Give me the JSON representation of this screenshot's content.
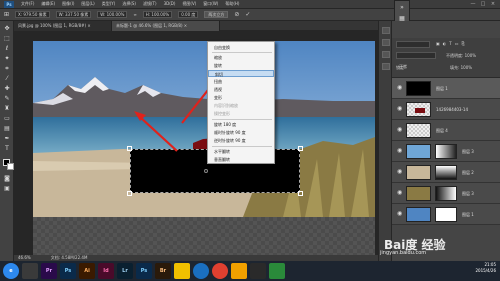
{
  "menubar": {
    "logo": "Ps",
    "items": [
      "文件(F)",
      "编辑(E)",
      "图像(I)",
      "图层(L)",
      "类型(Y)",
      "选择(S)",
      "滤镜(T)",
      "3D(D)",
      "视图(V)",
      "窗口(W)",
      "帮助(H)"
    ],
    "window_controls": [
      "—",
      "□",
      "×"
    ]
  },
  "options_bar": {
    "x": "X: 979.50 像素",
    "w": "W: 337.50 像素",
    "w_pct": "W: 100.00%",
    "h_pct": "H: 100.00%",
    "angle": "0.00 度",
    "interp": "两次立方",
    "commit_icon": "check-icon",
    "cancel_icon": "cancel-icon"
  },
  "doc_tabs": [
    {
      "label": "风景.jpg @ 100% (图层 1, RGB/8#) ×",
      "active": false
    },
    {
      "label": "未标题-1 @ 46.6% (图层 1, RGB/8) × ",
      "active": true
    }
  ],
  "status": {
    "zoom": "46.6%",
    "doc": "文档: 4.58M/22.4M"
  },
  "context_menu": {
    "items": [
      {
        "label": "自由变换",
        "disabled": false
      },
      {
        "label": "缩放",
        "disabled": false
      },
      {
        "label": "旋转",
        "disabled": false
      },
      {
        "label": "斜切",
        "disabled": false,
        "highlighted": true
      },
      {
        "label": "扭曲",
        "disabled": false
      },
      {
        "label": "透视",
        "disabled": false
      },
      {
        "label": "变形",
        "disabled": false
      },
      {
        "label": "内容识别缩放",
        "disabled": true
      },
      {
        "label": "操控变形",
        "disabled": true
      },
      {
        "label": "旋转 180 度",
        "disabled": false
      },
      {
        "label": "顺时针旋转 90 度",
        "disabled": false
      },
      {
        "label": "逆时针旋转 90 度",
        "disabled": false
      },
      {
        "label": "水平翻转",
        "disabled": false
      },
      {
        "label": "垂直翻转",
        "disabled": false
      }
    ]
  },
  "layers_panel": {
    "filter_label": "类型",
    "blend_mode": "正常",
    "opacity_label": "不透明度: 100%",
    "lock_label": "锁定:",
    "fill_label": "填充: 100%",
    "layers": [
      {
        "name": "图层 1",
        "selected": true
      },
      {
        "name": "1426984403-14",
        "selected": false
      },
      {
        "name": "图层 4",
        "selected": false
      },
      {
        "name": "图层 3",
        "selected": false
      },
      {
        "name": "图层 2",
        "selected": false
      },
      {
        "name": "图层 3",
        "selected": false
      },
      {
        "name": "图层 1",
        "selected": false
      }
    ]
  },
  "taskbar": {
    "apps": [
      {
        "label": "e",
        "color": "#2d89ef"
      },
      {
        "label": "",
        "color": "#3a3a3a"
      },
      {
        "label": "Pr",
        "color": "#2a0a4a"
      },
      {
        "label": "Ps",
        "color": "#0a2a4a"
      },
      {
        "label": "Ai",
        "color": "#3a1a00"
      },
      {
        "label": "Id",
        "color": "#4a0a2a"
      },
      {
        "label": "Lr",
        "color": "#0a2030"
      },
      {
        "label": "Ps",
        "color": "#0a2a4a"
      },
      {
        "label": "Br",
        "color": "#2a1a0a"
      },
      {
        "label": "",
        "color": "#f0c000"
      },
      {
        "label": "",
        "color": "#1a6fc0"
      },
      {
        "label": "",
        "color": "#e04030"
      },
      {
        "label": "",
        "color": "#f0a000"
      },
      {
        "label": "",
        "color": "#2a2a2a"
      },
      {
        "label": "",
        "color": "#2a8a3a"
      }
    ],
    "time": "21:05",
    "date": "2015/4/26"
  },
  "watermark": {
    "brand": "Bai度 经验",
    "url": "jingyan.baidu.com"
  }
}
